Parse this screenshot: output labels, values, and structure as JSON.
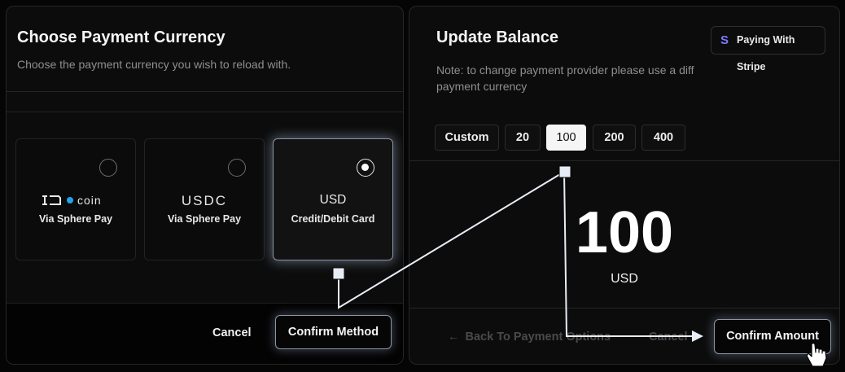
{
  "left_panel": {
    "title": "Choose Payment Currency",
    "subtitle": "Choose the payment currency you wish to reload with.",
    "cards": [
      {
        "logo": "◎ coin",
        "label": "Via Sphere Pay",
        "selected": false
      },
      {
        "logo": "USDC",
        "label": "Via Sphere Pay",
        "selected": false
      },
      {
        "logo": "USD",
        "label": "Credit/Debit Card",
        "selected": true
      }
    ],
    "cancel_label": "Cancel",
    "confirm_label": "Confirm Method"
  },
  "right_panel": {
    "title": "Update Balance",
    "badge": {
      "icon": "stripe-s-icon",
      "label": "Paying With Stripe"
    },
    "note": "Note: to change payment provider please use a diff payment currency",
    "amounts": [
      "Custom",
      "20",
      "100",
      "200",
      "400"
    ],
    "selected_amount": "100",
    "big_amount": "100",
    "currency": "USD",
    "back_label": "Back To Payment Options",
    "cancel_label": "Cancel",
    "confirm_label": "Confirm Amount"
  },
  "colors": {
    "background": "#050505",
    "panel": "#0c0c0c",
    "accent_stripe": "#7d7aff",
    "glow_border": "#8d96a5"
  }
}
